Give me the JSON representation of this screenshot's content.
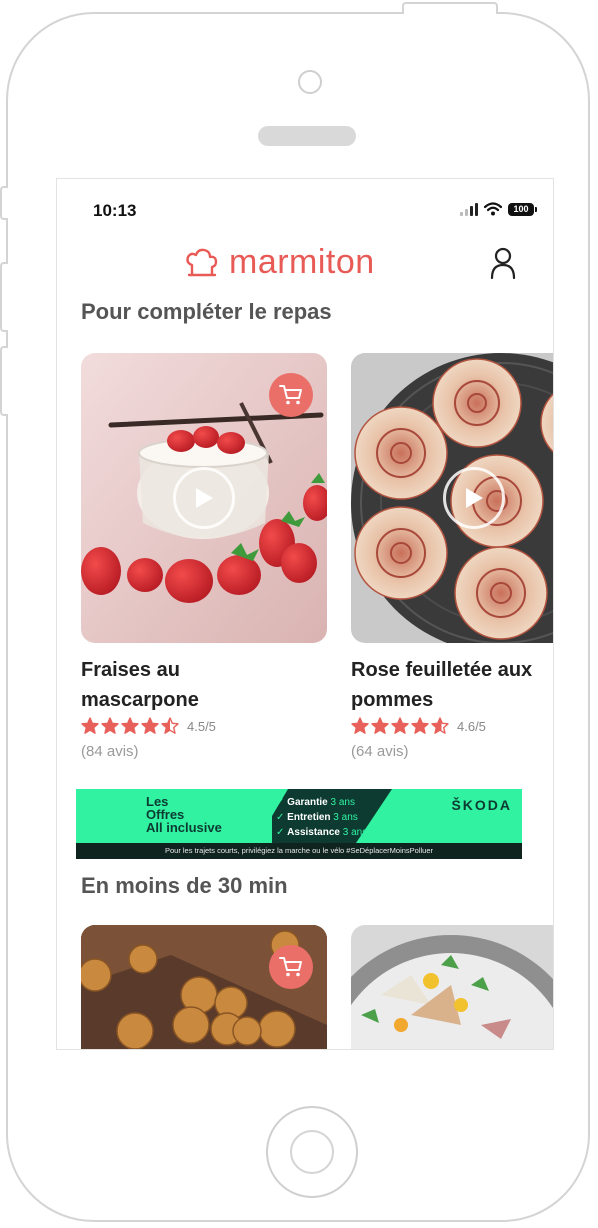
{
  "status_bar": {
    "time": "10:13",
    "battery": "100"
  },
  "header": {
    "logo_text": "marmiton"
  },
  "sections": [
    {
      "title": "Pour compléter le repas"
    },
    {
      "title": "En moins de 30 min"
    }
  ],
  "cards": [
    {
      "title": "Fraises au mascarpone",
      "rating": "4.5/5",
      "rating_stars": 4.5,
      "reviews": "(84 avis)"
    },
    {
      "title": "Rose feuilletée aux pommes",
      "rating": "4.6/5",
      "rating_stars": 4.6,
      "reviews": "(64 avis)"
    }
  ],
  "ad": {
    "offer_line1": "Les",
    "offer_line2": "Offres",
    "offer_line3": "All inclusive",
    "items": [
      {
        "label": "Garantie",
        "value": "3 ans"
      },
      {
        "label": "Entretien",
        "value": "3 ans"
      },
      {
        "label": "Assistance",
        "value": "3 ans"
      }
    ],
    "brand": "ŠKODA",
    "footer": "Pour les trajets courts, privilégiez la marche ou le vélo #SeDéplacerMoinsPolluer"
  },
  "colors": {
    "brand": "#e85a55",
    "cart": "#ea6f68",
    "star": "#e8605a",
    "ad_green": "#30f2a1",
    "ad_dark": "#0d3b32"
  },
  "icons": [
    "cart-icon",
    "play-icon",
    "account-icon",
    "star-icon",
    "wifi-icon",
    "signal-icon",
    "battery-icon",
    "chef-hat-logo-icon"
  ]
}
